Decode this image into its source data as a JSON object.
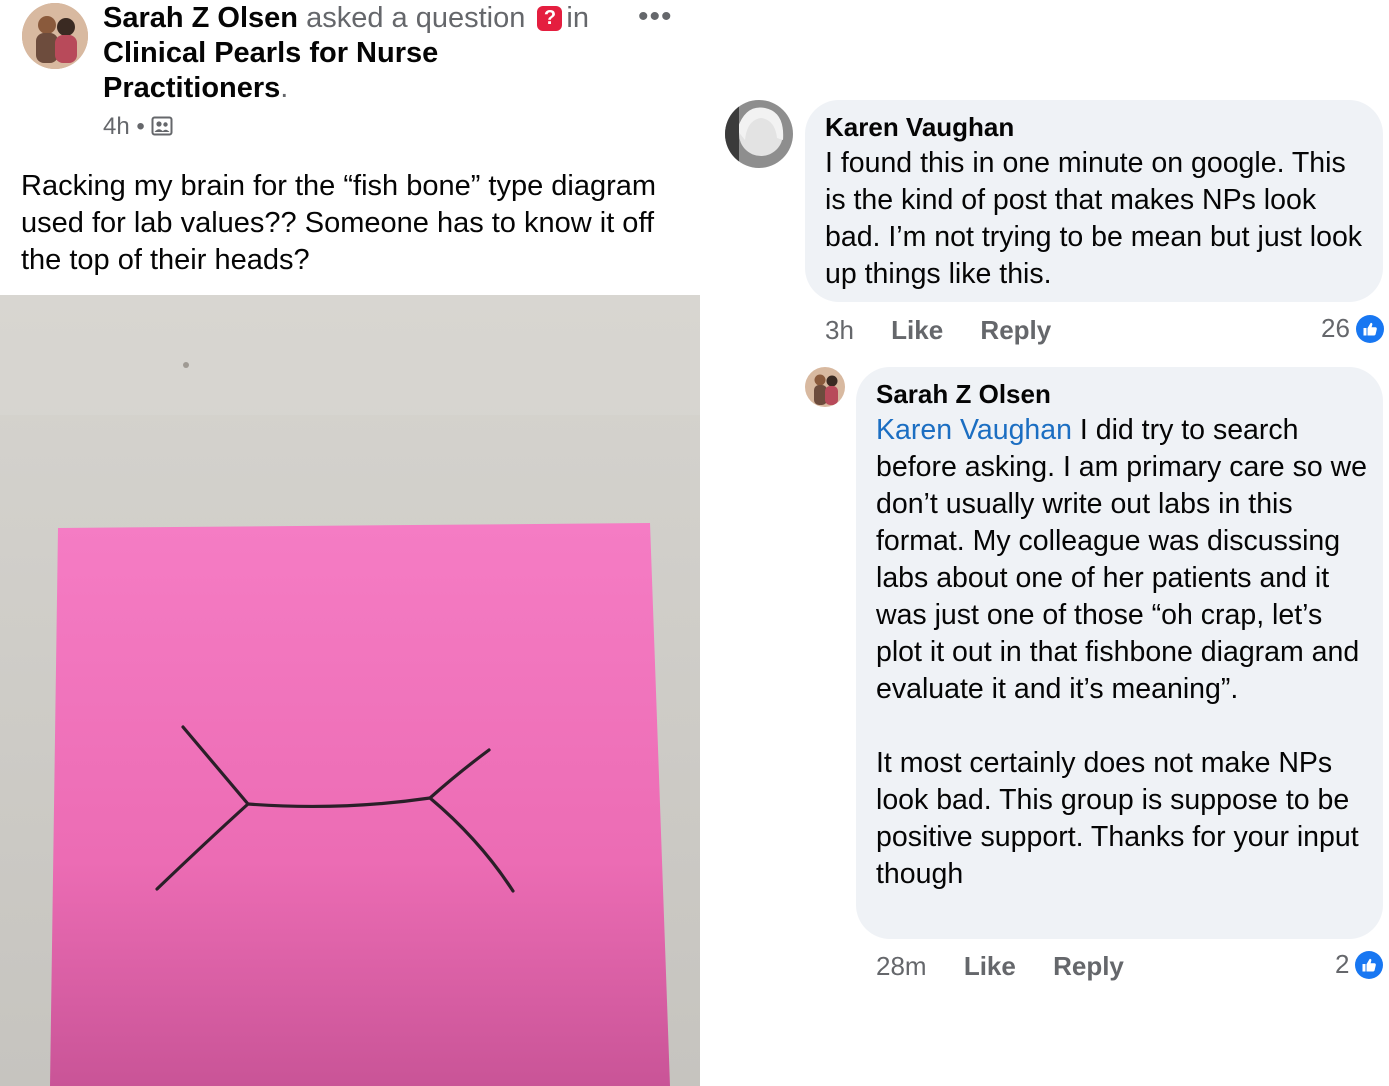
{
  "post": {
    "author": "Sarah Z Olsen",
    "action": "asked a question",
    "in_word": "in",
    "group": "Clinical Pearls for Nurse Practitioners",
    "group_period": ".",
    "time": "4h",
    "dot": "•",
    "text": "Racking my brain for the “fish bone” type diagram used for lab values?? Someone has to know it off the top of their heads?",
    "more": "•••"
  },
  "comments": [
    {
      "author": "Karen Vaughan",
      "text": "I found this in one minute on google. This is the kind of post that makes NPs look bad. I’m not trying to be mean but just look up things like this.",
      "time": "3h",
      "like": "Like",
      "reply": "Reply",
      "reactions": "26"
    },
    {
      "author": "Sarah Z Olsen",
      "mention": "Karen Vaughan",
      "text": " I did try to search before asking. I am primary care so we don’t usually write out labs in this format. My colleague was discussing labs about one of her patients and it was just one of those “oh crap, let’s plot it out in that fishbone diagram and evaluate it and it’s meaning”.\n\nIt most certainly does not make NPs look bad.  This group is suppose to be positive support. Thanks for your input though",
      "time": "28m",
      "like": "Like",
      "reply": "Reply",
      "reactions": "2"
    }
  ],
  "icons": {
    "question": "question-icon",
    "privacy": "group-privacy-icon",
    "like_reaction": "thumbs-up-icon"
  },
  "colors": {
    "like_blue": "#1877f2",
    "bubble": "#eff2f6",
    "mention": "#1b6ec2",
    "question_badge": "#e41e3f",
    "sticky_note": "#f276bd"
  }
}
